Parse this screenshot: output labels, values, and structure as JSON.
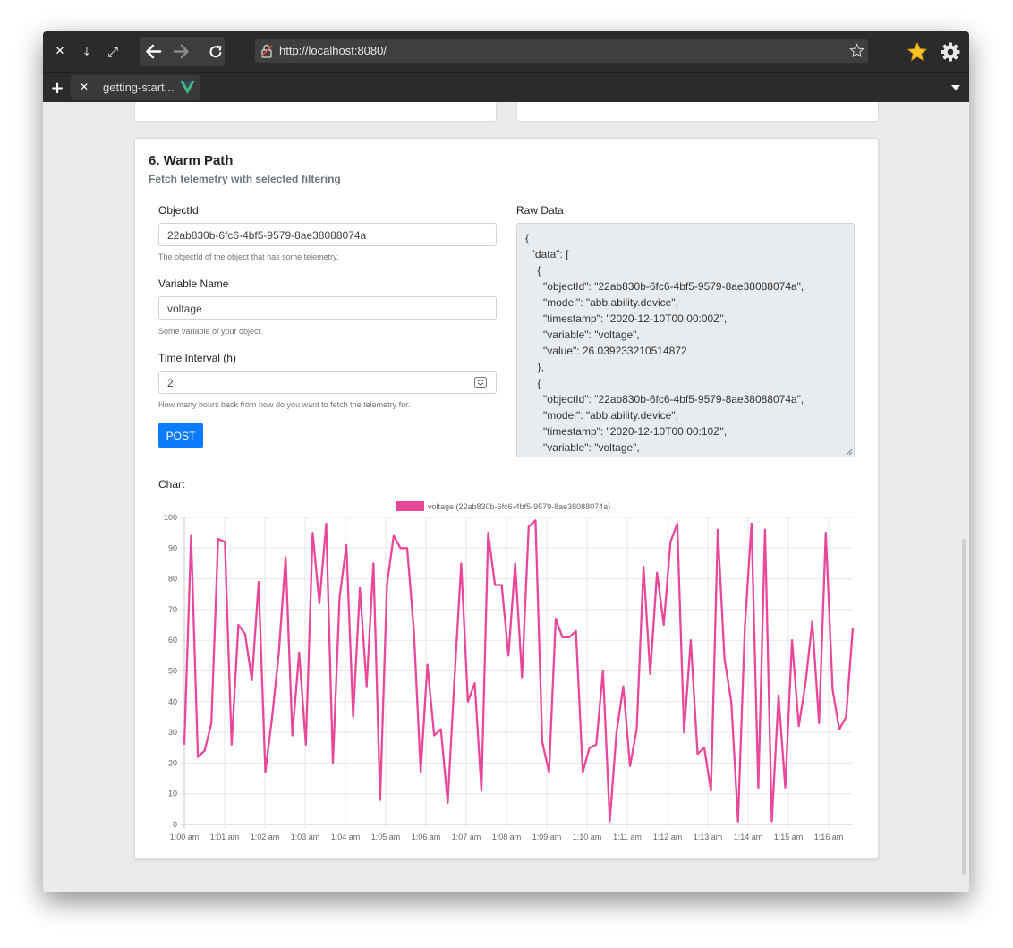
{
  "browser": {
    "url": "http://localhost:8080/",
    "tab_title": "getting-start...",
    "controls": {
      "close": "✕",
      "download": "⤓",
      "fullscreen": "⤢"
    }
  },
  "card": {
    "title": "6. Warm Path",
    "subtitle": "Fetch telemetry with selected filtering"
  },
  "form": {
    "object_id_label": "ObjectId",
    "object_id_value": "22ab830b-6fc6-4bf5-9579-8ae38088074a",
    "object_id_help": "The objectId of the object that has some telemetry.",
    "variable_label": "Variable Name",
    "variable_value": "voltage",
    "variable_help": "Some variable of your object.",
    "interval_label": "Time Interval (h)",
    "interval_value": "2",
    "interval_help": "How many hours back from now do you want to fetch the telemetry for.",
    "post_label": "POST"
  },
  "raw": {
    "label": "Raw Data",
    "text": "{\n  \"data\": [\n    {\n      \"objectId\": \"22ab830b-6fc6-4bf5-9579-8ae38088074a\",\n      \"model\": \"abb.ability.device\",\n      \"timestamp\": \"2020-12-10T00:00:00Z\",\n      \"variable\": \"voltage\",\n      \"value\": 26.039233210514872\n    },\n    {\n      \"objectId\": \"22ab830b-6fc6-4bf5-9579-8ae38088074a\",\n      \"model\": \"abb.ability.device\",\n      \"timestamp\": \"2020-12-10T00:00:10Z\",\n      \"variable\": \"voltage\",\n      \"value\": "
  },
  "chart_label": "Chart",
  "colors": {
    "series": "#e8479a",
    "accent": "#0d7bff"
  },
  "chart_data": {
    "type": "line",
    "legend": "voltage (22ab830b-6fc6-4bf5-9579-8ae38088074a)",
    "ylim": [
      0,
      100
    ],
    "yticks": [
      0,
      10,
      20,
      30,
      40,
      50,
      60,
      70,
      80,
      90,
      100
    ],
    "xlim_minutes": [
      0,
      16.6
    ],
    "xticks": [
      "1:00 am",
      "1:01 am",
      "1:02 am",
      "1:03 am",
      "1:04 am",
      "1:05 am",
      "1:06 am",
      "1:07 am",
      "1:08 am",
      "1:09 am",
      "1:10 am",
      "1:11 am",
      "1:12 am",
      "1:13 am",
      "1:14 am",
      "1:15 am",
      "1:16 am"
    ],
    "grid": true,
    "values": [
      26,
      94,
      22,
      24,
      33,
      93,
      92,
      26,
      65,
      62,
      47,
      79,
      17,
      35,
      56,
      87,
      29,
      56,
      26,
      95,
      72,
      98,
      20,
      74,
      91,
      35,
      77,
      45,
      85,
      8,
      78,
      94,
      90,
      90,
      63,
      17,
      52,
      29,
      31,
      7,
      47,
      85,
      40,
      46,
      11,
      95,
      78,
      78,
      55,
      85,
      48,
      97,
      99,
      27,
      17,
      67,
      61,
      61,
      63,
      17,
      25,
      26,
      50,
      1,
      30,
      45,
      19,
      31,
      84,
      49,
      82,
      65,
      92,
      98,
      30,
      60,
      23,
      25,
      11,
      96,
      54,
      40,
      1,
      64,
      98,
      12,
      96,
      1,
      42,
      12,
      60,
      32,
      46,
      66,
      33,
      95,
      44,
      31,
      35,
      64
    ]
  }
}
